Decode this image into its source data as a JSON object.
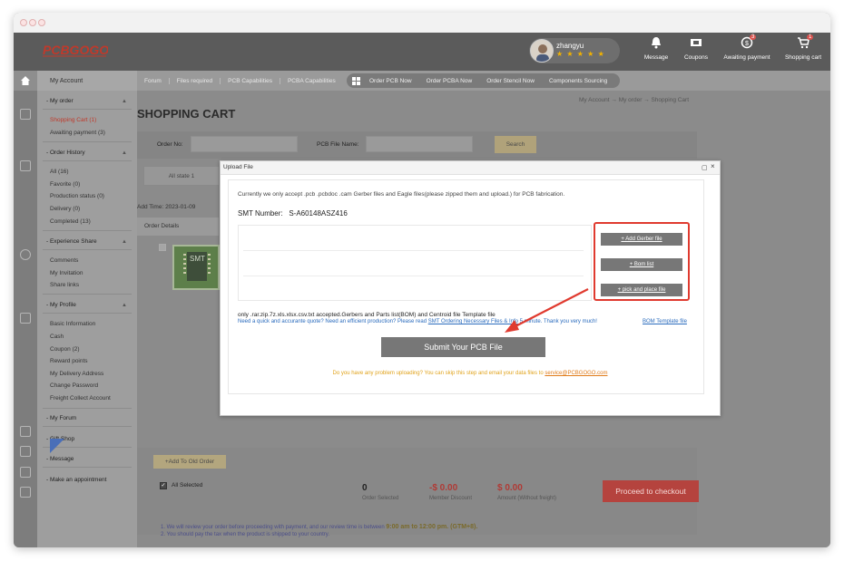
{
  "header": {
    "logo": "PCBGOGO",
    "user": {
      "name": "zhangyu",
      "stars": "★ ★ ★ ★ ★"
    },
    "icons": [
      {
        "icon": "bell-icon",
        "label": "Message",
        "badge": ""
      },
      {
        "icon": "coupon-icon",
        "label": "Coupons",
        "badge": ""
      },
      {
        "icon": "wallet-icon",
        "label": "Awaiting payment",
        "badge": "3"
      },
      {
        "icon": "cart-icon",
        "label": "Shopping cart",
        "badge": "1"
      }
    ]
  },
  "nav": {
    "my_account": "My Account",
    "links": [
      "Forum",
      "Files required",
      "PCB Capabilities",
      "PCBA Capabilities"
    ],
    "order_links": [
      "Order PCB Now",
      "Order PCBA Now",
      "Order Stencil Now",
      "Components Sourcing"
    ]
  },
  "sidebar": {
    "my_order": "- My order",
    "shopping_cart": "Shopping Cart (1)",
    "awaiting_payment": "Awaiting payment (3)",
    "order_history": "- Order History",
    "history_items": [
      "All (16)",
      "Favorite (0)",
      "Production status (0)",
      "Delivery (0)",
      "Completed (13)"
    ],
    "experience_share": "- Experience Share",
    "share_items": [
      "Comments",
      "My Invitation",
      "Share links"
    ],
    "my_profile": "- My Profile",
    "profile_items": [
      "Basic Information",
      "Cash",
      "Coupon (2)",
      "Reward points",
      "My Delivery Address",
      "Change Password",
      "Freight Collect Account"
    ],
    "my_forum": "- My Forum",
    "gift_shop": "- Gift Shop",
    "message": "- Message",
    "appointment": "- Make an appointment"
  },
  "main": {
    "breadcrumb": "My Account  →  My order  →  Shopping Cart",
    "title": "SHOPPING CART",
    "order_no_label": "Order No:",
    "pcb_file_label": "PCB File Name:",
    "search_button": "Search",
    "tab_all": "All state 1",
    "add_time": "Add Time: 2023-01-09",
    "order_details": "Order Details",
    "thumb_text": "SMT"
  },
  "dialog": {
    "title": "Upload File",
    "accept_text": "Currently we only accept .pcb .pcbdoc .cam Gerber files and Eagle files(please zipped them and upload.) for PCB fabrication.",
    "smt_label": "SMT Number:",
    "smt_value": "S-A60148ASZ416",
    "buttons": [
      "+ Add Gerber file",
      "+ Bom list",
      "+ pick and place file"
    ],
    "only_text": "only .rar.zip.7z.xls.xlsx.csv.txt accepted.Gerbers and Parts list(BOM) and Centroid file Template file",
    "need_text_1": "Need a quick and accurante quote? Need an efficient production? Please read",
    "need_link": "SMT Ordering Necessary Files & Info",
    "need_text_2": "5 minute. Thank you very much!",
    "bom_template": "BOM Template file",
    "submit": "Submit Your PCB File",
    "problem_text": "Do you have any problem uploading? You can skip this step and email your data files to",
    "problem_email": "service@PCBGOGO.com"
  },
  "footer": {
    "add_to_old_order": "+Add To Old Order",
    "all_selected": "All Selected",
    "order_selected_value": "0",
    "order_selected_label": "Order Selected",
    "member_discount_value": "-$ 0.00",
    "member_discount_label": "Member Discount",
    "amount_value": "$ 0.00",
    "amount_label": "Amount (Without freight)",
    "checkout": "Proceed to checkout",
    "note1_a": "1. We will review your order before proceeding with payment, and our review time is between",
    "note1_b": "9:00 am to 12:00 pm. (GTM+8).",
    "note2": "2. You should pay the tax when the product is shipped to your country."
  },
  "colors": {
    "accent_red": "#e03a2f",
    "link_blue": "#2a6bbd",
    "notice_orange": "#e0a21a"
  }
}
